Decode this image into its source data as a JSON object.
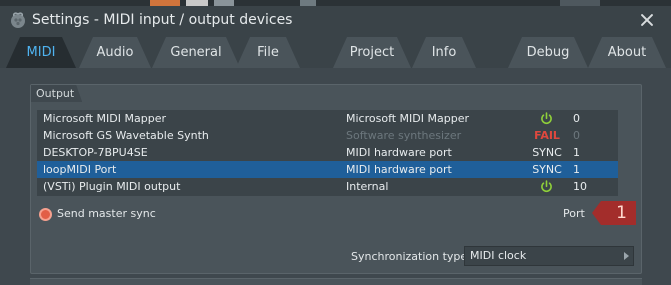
{
  "window": {
    "title": "Settings - MIDI input / output devices",
    "icon": "fl-fruit-icon"
  },
  "tabs": [
    {
      "label": "MIDI",
      "active": true
    },
    {
      "label": "Audio",
      "active": false
    },
    {
      "label": "General",
      "active": false
    },
    {
      "label": "File",
      "active": false
    },
    {
      "label": "Project",
      "active": false
    },
    {
      "label": "Info",
      "active": false
    },
    {
      "label": "Debug",
      "active": false
    },
    {
      "label": "About",
      "active": false
    }
  ],
  "output": {
    "group_label": "Output",
    "devices": [
      {
        "name": "Microsoft MIDI Mapper",
        "type": "Microsoft MIDI Mapper",
        "status": "power-icon",
        "port": "0",
        "selected": false
      },
      {
        "name": "Microsoft GS Wavetable Synth",
        "type": "Software synthesizer",
        "status": "FAIL",
        "port": "0",
        "selected": false
      },
      {
        "name": "DESKTOP-7BPU4SE",
        "type": "MIDI hardware port",
        "status": "SYNC",
        "port": "1",
        "selected": false
      },
      {
        "name": "loopMIDI Port",
        "type": "MIDI hardware port",
        "status": "SYNC",
        "port": "1",
        "selected": true
      },
      {
        "name": "(VSTi) Plugin MIDI output",
        "type": "Internal",
        "status": "power-icon",
        "port": "10",
        "selected": false
      }
    ],
    "send_master_sync": {
      "label": "Send master sync",
      "checked": true
    },
    "port": {
      "label": "Port",
      "value": "1"
    },
    "sync_type": {
      "label": "Synchronization type",
      "value": "MIDI clock"
    }
  },
  "colors": {
    "accent": "#4fb3f0",
    "selection": "#1f5f9a",
    "fail": "#e0483e",
    "power_on": "#8fcf3a",
    "port_badge": "#a32d2b"
  }
}
